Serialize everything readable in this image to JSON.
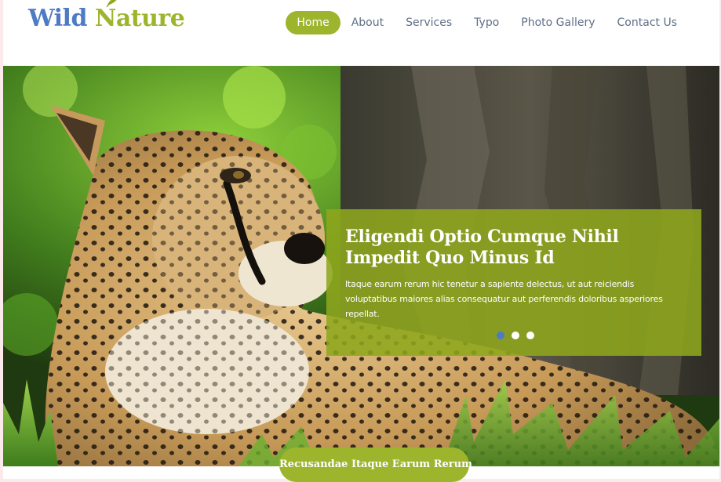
{
  "brand": {
    "word1": "Wild",
    "word2": "Nature",
    "leaf_icon": "leaf-icon"
  },
  "nav": {
    "items": [
      {
        "label": "Home",
        "active": true
      },
      {
        "label": "About",
        "active": false
      },
      {
        "label": "Services",
        "active": false
      },
      {
        "label": "Typo",
        "active": false
      },
      {
        "label": "Photo Gallery",
        "active": false
      },
      {
        "label": "Contact Us",
        "active": false
      }
    ]
  },
  "hero": {
    "image_subject": "cheetah lying in grass",
    "caption": {
      "title": "Eligendi Optio Cumque Nihil Impedit Quo Minus Id",
      "text": "Itaque earum rerum hic tenetur a sapiente delectus, ut aut reiciendis voluptatibus maiores alias consequatur aut perferendis doloribus asperiores repellat."
    },
    "slides": {
      "count": 3,
      "active_index": 0
    },
    "cta_label": "Recusandae Itaque Earum Rerum"
  },
  "colors": {
    "accent_green": "#9cb52d",
    "brand_blue": "#4e7bc4",
    "nav_text": "#5f6f86",
    "caption_bg": "#8ea61c"
  }
}
